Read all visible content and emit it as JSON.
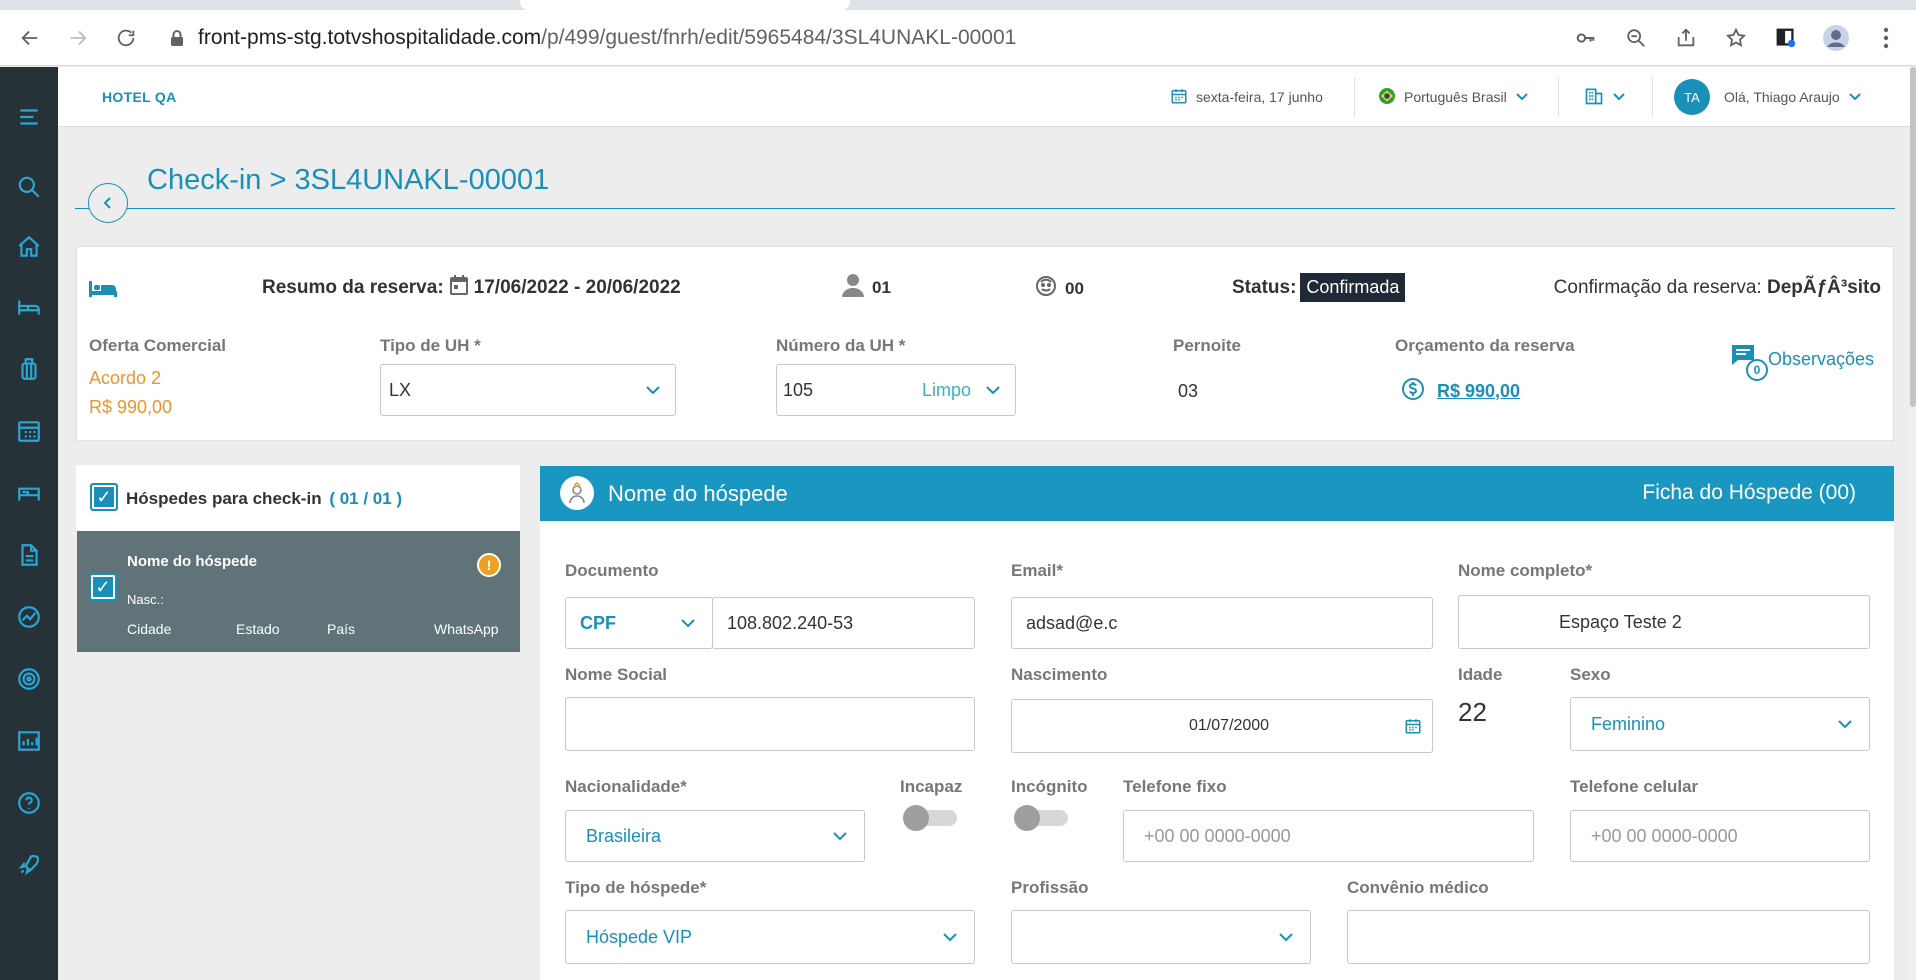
{
  "browser": {
    "url_host": "front-pms-stg.totvshospitalidade.com",
    "url_path": "/p/499/guest/fnrh/edit/5965484/3SL4UNAKL-00001"
  },
  "header": {
    "hotel": "HOTEL QA",
    "date": "sexta-feira, 17 junho",
    "language": "Português Brasil",
    "avatar_initials": "TA",
    "greeting": "Olá, Thiago Araujo"
  },
  "page": {
    "title": "Check-in > 3SL4UNAKL-00001"
  },
  "reservation": {
    "summary_label": "Resumo da reserva:",
    "dates": "17/06/2022 - 20/06/2022",
    "adults": "01",
    "children": "00",
    "status_label": "Status:",
    "status_value": "Confirmada",
    "confirmation_label": "Confirmação da reserva:",
    "confirmation_value": "DepÃƒÂ³sito",
    "offer_label": "Oferta Comercial",
    "offer_name": "Acordo 2",
    "offer_price": "R$ 990,00",
    "uh_type_label": "Tipo de UH *",
    "uh_type_value": "LX",
    "uh_number_label": "Número da UH *",
    "uh_number_value": "105",
    "uh_number_status": "Limpo",
    "overnight_label": "Pernoite",
    "overnight_value": "03",
    "budget_label": "Orçamento da reserva",
    "budget_value": "R$ 990,00",
    "notes_count": "0",
    "notes_label": "Observações"
  },
  "guests_panel": {
    "title": "Hóspedes para check-in",
    "count": "( 01 / 01 )",
    "guest_name": "Nome do hóspede",
    "birth_label": "Nasc.:",
    "city": "Cidade",
    "state": "Estado",
    "country": "País",
    "whatsapp": "WhatsApp",
    "warn_glyph": "!"
  },
  "form": {
    "header_name": "Nome do hóspede",
    "header_record": "Ficha do Hóspede (00)",
    "document_label": "Documento",
    "document_type": "CPF",
    "document_number": "108.802.240-53",
    "email_label": "Email*",
    "email_value": "adsad@e.c",
    "fullname_label": "Nome completo*",
    "fullname_value": "Espaço Teste 2",
    "social_name_label": "Nome Social",
    "birth_label": "Nascimento",
    "birth_value": "01/07/2000",
    "age_label": "Idade",
    "age_value": "22",
    "sex_label": "Sexo",
    "sex_value": "Feminino",
    "nationality_label": "Nacionalidade*",
    "nationality_value": "Brasileira",
    "incapaz_label": "Incapaz",
    "incognito_label": "Incógnito",
    "phone_label": "Telefone fixo",
    "phone_placeholder": "+00 00 0000-0000",
    "mobile_label": "Telefone celular",
    "mobile_placeholder": "+00 00 0000-0000",
    "guest_type_label": "Tipo de hóspede*",
    "guest_type_value": "Hóspede VIP",
    "profession_label": "Profissão",
    "health_label": "Convênio médico"
  },
  "colors": {
    "accent": "#1a8fb8",
    "sidebar": "#263238",
    "form_header": "#1a97c0",
    "guest_card": "#5f7378",
    "offer": "#f0932b",
    "status_badge": "#1f2a36"
  }
}
